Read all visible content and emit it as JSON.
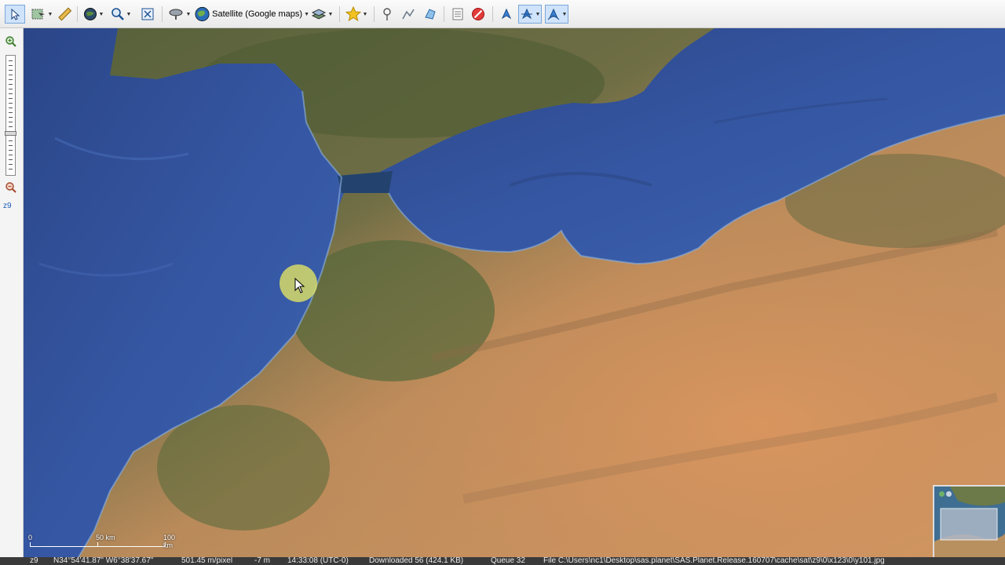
{
  "toolbar": {
    "map_source_label": "Satellite (Google maps)"
  },
  "zoom_panel": {
    "zoom_level": "z9"
  },
  "scale": {
    "marks": [
      "0",
      "50 km",
      "100 km"
    ]
  },
  "status_bar": {
    "zoom": "z9",
    "coordinates": "N34°54'41.87\" W6°38'37.67\"",
    "resolution": "501.45 m/pixel",
    "elevation": "-7 m",
    "time": "14:33:08 (UTC-0)",
    "downloaded": "Downloaded 56 (424.1 KB)",
    "queue": "Queue 32",
    "file": "File C:\\Users\\nc1\\Desktop\\sas.planet\\SAS.Planet.Release.160707\\cache\\sat\\z9\\0\\x123\\0\\y101.jpg"
  },
  "icons": [
    "pointer-icon",
    "select-area-icon",
    "ruler-icon",
    "globe-layers-icon",
    "zoom-tool-icon",
    "fullscreen-icon",
    "satellite-dish-icon",
    "globe-icon",
    "layers-icon",
    "star-icon",
    "placemark-icon",
    "path-icon",
    "polygon-icon",
    "marks-list-icon",
    "stop-icon",
    "gps-icon",
    "center-gps-icon",
    "track-gps-icon",
    "zoom-in-icon",
    "zoom-out-icon"
  ],
  "colors": {
    "sea": "#2f4f95",
    "land_green": "#5f6a3e",
    "land_desert": "#c98e5e",
    "status_bg": "#3a3a3a",
    "zoom_level_text": "#1c5fb8"
  }
}
